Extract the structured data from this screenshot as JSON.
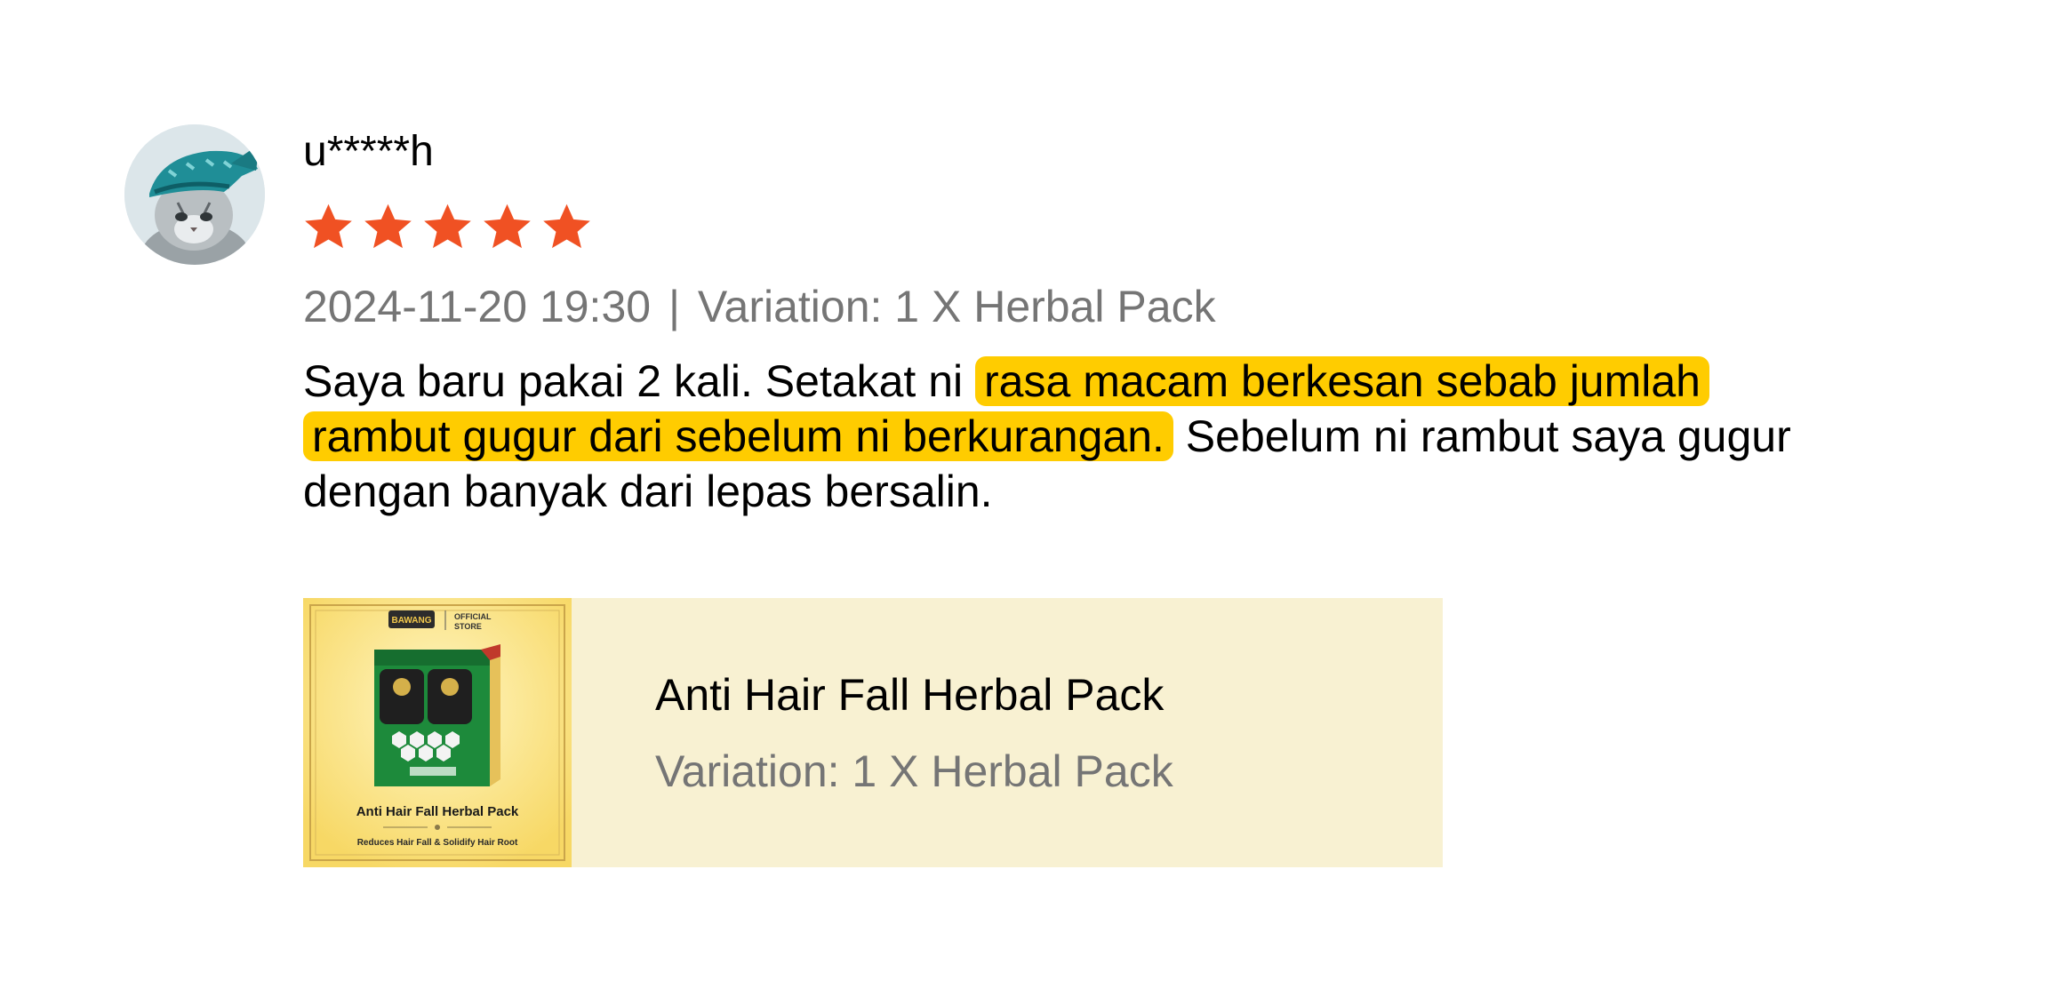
{
  "review": {
    "username": "u*****h",
    "rating": 5,
    "rating_max": 5,
    "date": "2024-11-20 19:30",
    "separator": "|",
    "variation_text": "Variation: 1 X Herbal Pack",
    "body_before": "Saya baru pakai 2 kali. Setakat ni",
    "body_highlight": "rasa macam berkesan sebab jumlah rambut gugur dari sebelum ni berkurangan.",
    "body_after": "Sebelum ni rambut saya gugur dengan banyak dari lepas bersalin."
  },
  "product": {
    "title": "Anti Hair Fall Herbal Pack",
    "variation": "Variation: 1 X Herbal Pack",
    "thumbnail": {
      "brand": "BAWANG",
      "store_label_1": "OFFICIAL",
      "store_label_2": "STORE",
      "pack_title": "Anti Hair Fall Herbal Pack",
      "pack_subtitle": "Reduces Hair Fall & Solidify Hair Root"
    }
  },
  "colors": {
    "star": "#f05123",
    "highlight": "#ffcc00",
    "meta_text": "#757575",
    "card_background": "#f8f1d2"
  },
  "icons": {
    "avatar": "cat-avatar",
    "star": "star-icon"
  }
}
